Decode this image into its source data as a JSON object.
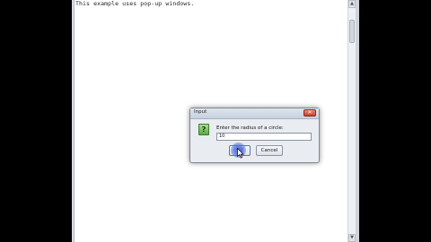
{
  "console": {
    "text": "This example uses pop-up windows."
  },
  "scrollbar": {
    "up_arrow": "▲",
    "down_arrow": "▼"
  },
  "dialog": {
    "title": "Input",
    "close_glyph": "✕",
    "icon_glyph": "?",
    "prompt": "Enter the radius of a circle:",
    "input_value": "10",
    "ok_label": "OK",
    "cancel_label": "Cancel"
  },
  "colors": {
    "background": "#000000",
    "frame": "#ffffff",
    "dialog": "#e9ecf1",
    "question_icon": "#5ca844",
    "click_highlight": "#506edc"
  }
}
